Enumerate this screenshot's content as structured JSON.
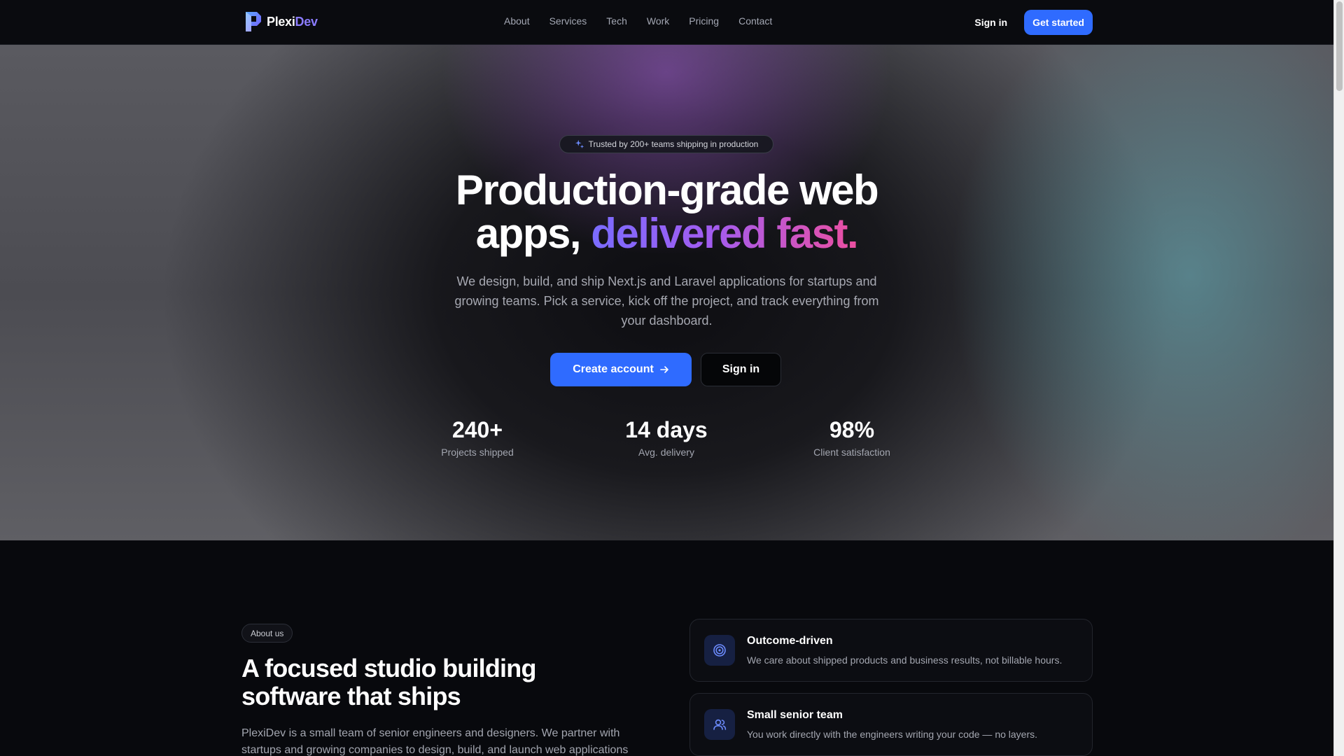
{
  "nav": {
    "brand_part1": "Plexi",
    "brand_part2": "Dev",
    "links": [
      "About",
      "Services",
      "Tech",
      "Work",
      "Pricing",
      "Contact"
    ],
    "signin": "Sign in",
    "get_started": "Get started"
  },
  "hero": {
    "badge": "Trusted by 200+ teams shipping in production",
    "title_line1": "Production-grade web",
    "title_line2_plain": "apps, ",
    "title_line2_gradient": "delivered fast.",
    "subtitle": "We design, build, and ship Next.js and Laravel applications for startups and growing teams. Pick a service, kick off the project, and track everything from your dashboard.",
    "cta_primary": "Create account",
    "cta_secondary": "Sign in",
    "stats": [
      {
        "value": "240+",
        "label": "Projects shipped"
      },
      {
        "value": "14 days",
        "label": "Avg. delivery"
      },
      {
        "value": "98%",
        "label": "Client satisfaction"
      }
    ]
  },
  "about": {
    "pill": "About us",
    "title": "A focused studio building software that ships",
    "text": "PlexiDev is a small team of senior engineers and designers. We partner with startups and growing companies to design, build, and launch web applications",
    "features": [
      {
        "title": "Outcome-driven",
        "desc": "We care about shipped products and business results, not billable hours.",
        "icon": "target-icon"
      },
      {
        "title": "Small senior team",
        "desc": "You work directly with the engineers writing your code — no layers.",
        "icon": "users-icon"
      }
    ]
  },
  "colors": {
    "accent": "#2f6bff",
    "brand_secondary": "#8b7cff",
    "gradient_start": "#7a6cff",
    "gradient_end": "#ec4fa0",
    "background": "#08090d"
  }
}
